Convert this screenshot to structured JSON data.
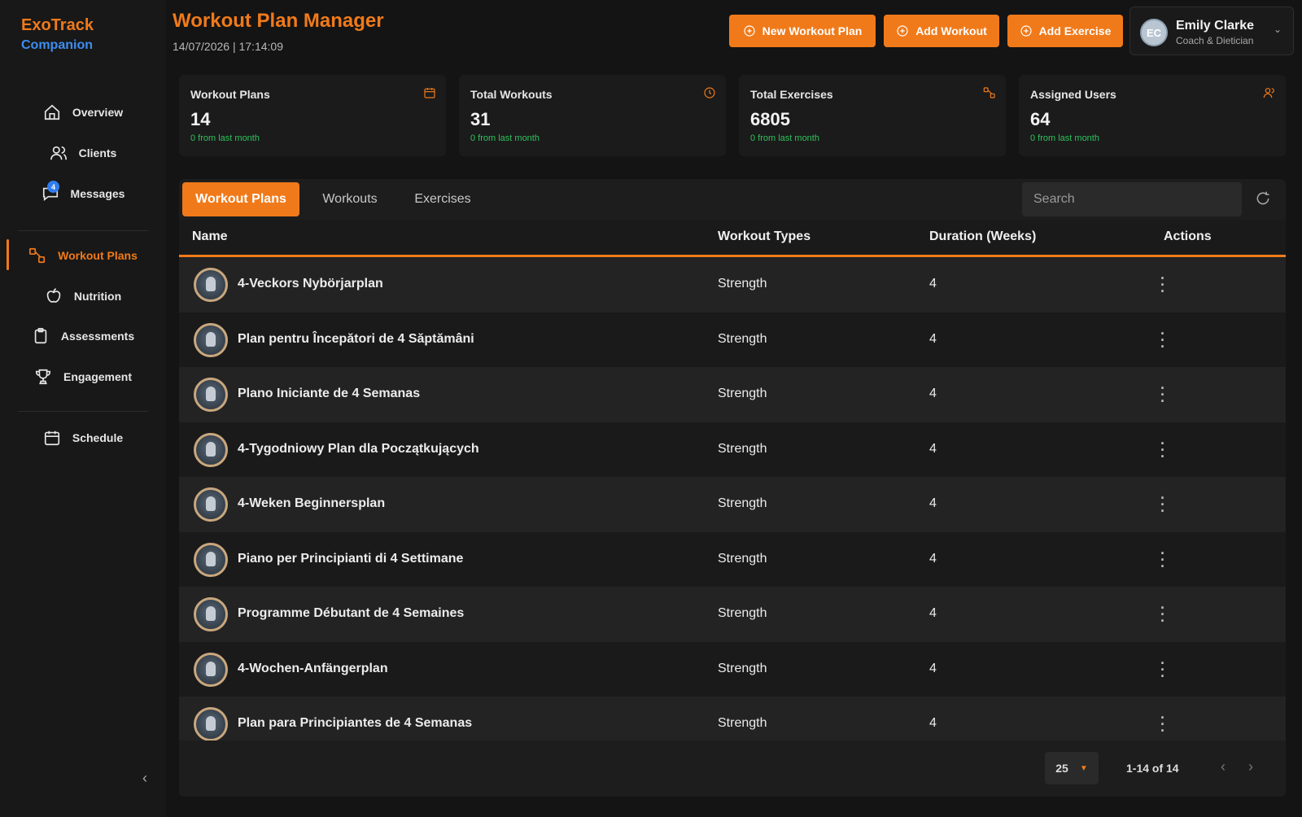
{
  "brand": {
    "line1": "ExoTrack",
    "line2": "Companion"
  },
  "sidebar": {
    "items": [
      {
        "label": "Overview",
        "icon": "home-icon"
      },
      {
        "label": "Clients",
        "icon": "users-icon"
      },
      {
        "label": "Messages",
        "icon": "chat-icon",
        "badge": "4"
      },
      {
        "label": "Workout Plans",
        "icon": "dumbbell-icon",
        "active": true
      },
      {
        "label": "Nutrition",
        "icon": "apple-icon"
      },
      {
        "label": "Assessments",
        "icon": "clipboard-icon"
      },
      {
        "label": "Engagement",
        "icon": "trophy-icon"
      },
      {
        "label": "Schedule",
        "icon": "calendar-icon"
      }
    ]
  },
  "header": {
    "title": "Workout Plan Manager",
    "datetime": "14/07/2026 | 17:14:09",
    "buttons": {
      "new_plan": "New Workout Plan",
      "add_workout": "Add Workout",
      "add_exercise": "Add Exercise"
    },
    "user": {
      "initials": "EC",
      "name": "Emily Clarke",
      "role": "Coach & Dietician"
    }
  },
  "stats": [
    {
      "label": "Workout Plans",
      "value": "14",
      "sub": "0 from last month",
      "icon": "calendar-icon"
    },
    {
      "label": "Total Workouts",
      "value": "31",
      "sub": "0 from last month",
      "icon": "clock-icon"
    },
    {
      "label": "Total Exercises",
      "value": "6805",
      "sub": "0 from last month",
      "icon": "dumbbell-icon"
    },
    {
      "label": "Assigned Users",
      "value": "64",
      "sub": "0 from last month",
      "icon": "users-icon"
    }
  ],
  "tabs": [
    {
      "label": "Workout Plans",
      "active": true
    },
    {
      "label": "Workouts"
    },
    {
      "label": "Exercises"
    }
  ],
  "search": {
    "placeholder": "Search"
  },
  "table": {
    "columns": [
      "Name",
      "Workout Types",
      "Duration (Weeks)",
      "Actions"
    ],
    "rows": [
      {
        "name": "4-Veckors Nybörjarplan",
        "type": "Strength",
        "duration": "4"
      },
      {
        "name": "Plan pentru Începători de 4 Săptămâni",
        "type": "Strength",
        "duration": "4"
      },
      {
        "name": "Plano Iniciante de 4 Semanas",
        "type": "Strength",
        "duration": "4"
      },
      {
        "name": "4-Tygodniowy Plan dla Początkujących",
        "type": "Strength",
        "duration": "4"
      },
      {
        "name": "4-Weken Beginnersplan",
        "type": "Strength",
        "duration": "4"
      },
      {
        "name": "Piano per Principianti di 4 Settimane",
        "type": "Strength",
        "duration": "4"
      },
      {
        "name": "Programme Débutant de 4 Semaines",
        "type": "Strength",
        "duration": "4"
      },
      {
        "name": "4-Wochen-Anfängerplan",
        "type": "Strength",
        "duration": "4"
      },
      {
        "name": "Plan para Principiantes de 4 Semanas",
        "type": "Strength",
        "duration": "4"
      }
    ]
  },
  "pagination": {
    "rows_per_page": "25",
    "range": "1-14 of 14"
  },
  "colors": {
    "accent": "#f07a1a",
    "link": "#3d8ef0",
    "positive": "#2fc25c"
  }
}
